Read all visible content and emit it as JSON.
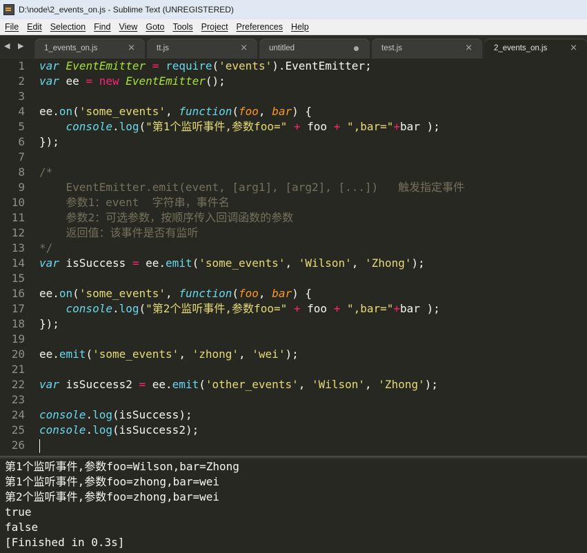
{
  "window": {
    "title": "D:\\node\\2_events_on.js - Sublime Text (UNREGISTERED)"
  },
  "menu": [
    "File",
    "Edit",
    "Selection",
    "Find",
    "View",
    "Goto",
    "Tools",
    "Project",
    "Preferences",
    "Help"
  ],
  "tabbar": {
    "nav": "◀ ▶"
  },
  "tabs": [
    {
      "label": "1_events_on.js",
      "state": "close",
      "close": "×"
    },
    {
      "label": "tt.js",
      "state": "close",
      "close": "×"
    },
    {
      "label": "untitled",
      "state": "modified"
    },
    {
      "label": "test.js",
      "state": "close",
      "close": "×"
    },
    {
      "label": "2_events_on.js",
      "state": "active",
      "close": "×"
    }
  ],
  "code_lines": [
    {
      "n": "1",
      "tokens": [
        [
          "kw",
          "var"
        ],
        [
          "pl",
          " "
        ],
        [
          "cls",
          "EventEmitter"
        ],
        [
          "pl",
          " "
        ],
        [
          "op",
          "="
        ],
        [
          "pl",
          " "
        ],
        [
          "fn",
          "require"
        ],
        [
          "pl",
          "("
        ],
        [
          "str",
          "'events'"
        ],
        [
          "pl",
          ").EventEmitter;"
        ]
      ]
    },
    {
      "n": "2",
      "tokens": [
        [
          "kw",
          "var"
        ],
        [
          "pl",
          " ee "
        ],
        [
          "op",
          "="
        ],
        [
          "pl",
          " "
        ],
        [
          "op",
          "new"
        ],
        [
          "pl",
          " "
        ],
        [
          "cls",
          "EventEmitter"
        ],
        [
          "pl",
          "();"
        ]
      ]
    },
    {
      "n": "3",
      "tokens": []
    },
    {
      "n": "4",
      "tokens": [
        [
          "pl",
          "ee."
        ],
        [
          "fn",
          "on"
        ],
        [
          "pl",
          "("
        ],
        [
          "str",
          "'some_events'"
        ],
        [
          "pl",
          ", "
        ],
        [
          "kw",
          "function"
        ],
        [
          "pl",
          "("
        ],
        [
          "prm",
          "foo"
        ],
        [
          "pl",
          ", "
        ],
        [
          "prm",
          "bar"
        ],
        [
          "pl",
          ") {"
        ]
      ]
    },
    {
      "n": "5",
      "tokens": [
        [
          "pl",
          "    "
        ],
        [
          "kw",
          "console"
        ],
        [
          "pl",
          "."
        ],
        [
          "fn",
          "log"
        ],
        [
          "pl",
          "("
        ],
        [
          "str",
          "\"第1个监听事件,参数foo=\""
        ],
        [
          "pl",
          " "
        ],
        [
          "op",
          "+"
        ],
        [
          "pl",
          " foo "
        ],
        [
          "op",
          "+"
        ],
        [
          "pl",
          " "
        ],
        [
          "str",
          "\",bar=\""
        ],
        [
          "op",
          "+"
        ],
        [
          "pl",
          "bar );"
        ]
      ]
    },
    {
      "n": "6",
      "tokens": [
        [
          "pl",
          "});"
        ]
      ]
    },
    {
      "n": "7",
      "tokens": []
    },
    {
      "n": "8",
      "tokens": [
        [
          "cm",
          "/*"
        ]
      ]
    },
    {
      "n": "9",
      "tokens": [
        [
          "cm",
          "    EventEmitter.emit(event, [arg1], [arg2], [...])   触发指定事件"
        ]
      ]
    },
    {
      "n": "10",
      "tokens": [
        [
          "cm",
          "    参数1：event  字符串，事件名"
        ]
      ]
    },
    {
      "n": "11",
      "tokens": [
        [
          "cm",
          "    参数2：可选参数，按顺序传入回调函数的参数"
        ]
      ]
    },
    {
      "n": "12",
      "tokens": [
        [
          "cm",
          "    返回值：该事件是否有监听"
        ]
      ]
    },
    {
      "n": "13",
      "tokens": [
        [
          "cm",
          "*/"
        ]
      ]
    },
    {
      "n": "14",
      "tokens": [
        [
          "kw",
          "var"
        ],
        [
          "pl",
          " isSuccess "
        ],
        [
          "op",
          "="
        ],
        [
          "pl",
          " ee."
        ],
        [
          "fn",
          "emit"
        ],
        [
          "pl",
          "("
        ],
        [
          "str",
          "'some_events'"
        ],
        [
          "pl",
          ", "
        ],
        [
          "str",
          "'Wilson'"
        ],
        [
          "pl",
          ", "
        ],
        [
          "str",
          "'Zhong'"
        ],
        [
          "pl",
          ");"
        ]
      ]
    },
    {
      "n": "15",
      "tokens": []
    },
    {
      "n": "16",
      "tokens": [
        [
          "pl",
          "ee."
        ],
        [
          "fn",
          "on"
        ],
        [
          "pl",
          "("
        ],
        [
          "str",
          "'some_events'"
        ],
        [
          "pl",
          ", "
        ],
        [
          "kw",
          "function"
        ],
        [
          "pl",
          "("
        ],
        [
          "prm",
          "foo"
        ],
        [
          "pl",
          ", "
        ],
        [
          "prm",
          "bar"
        ],
        [
          "pl",
          ") {"
        ]
      ]
    },
    {
      "n": "17",
      "tokens": [
        [
          "pl",
          "    "
        ],
        [
          "kw",
          "console"
        ],
        [
          "pl",
          "."
        ],
        [
          "fn",
          "log"
        ],
        [
          "pl",
          "("
        ],
        [
          "str",
          "\"第2个监听事件,参数foo=\""
        ],
        [
          "pl",
          " "
        ],
        [
          "op",
          "+"
        ],
        [
          "pl",
          " foo "
        ],
        [
          "op",
          "+"
        ],
        [
          "pl",
          " "
        ],
        [
          "str",
          "\",bar=\""
        ],
        [
          "op",
          "+"
        ],
        [
          "pl",
          "bar );"
        ]
      ]
    },
    {
      "n": "18",
      "tokens": [
        [
          "pl",
          "});"
        ]
      ]
    },
    {
      "n": "19",
      "tokens": []
    },
    {
      "n": "20",
      "tokens": [
        [
          "pl",
          "ee."
        ],
        [
          "fn",
          "emit"
        ],
        [
          "pl",
          "("
        ],
        [
          "str",
          "'some_events'"
        ],
        [
          "pl",
          ", "
        ],
        [
          "str",
          "'zhong'"
        ],
        [
          "pl",
          ", "
        ],
        [
          "str",
          "'wei'"
        ],
        [
          "pl",
          ");"
        ]
      ]
    },
    {
      "n": "21",
      "tokens": []
    },
    {
      "n": "22",
      "tokens": [
        [
          "kw",
          "var"
        ],
        [
          "pl",
          " isSuccess2 "
        ],
        [
          "op",
          "="
        ],
        [
          "pl",
          " ee."
        ],
        [
          "fn",
          "emit"
        ],
        [
          "pl",
          "("
        ],
        [
          "str",
          "'other_events'"
        ],
        [
          "pl",
          ", "
        ],
        [
          "str",
          "'Wilson'"
        ],
        [
          "pl",
          ", "
        ],
        [
          "str",
          "'Zhong'"
        ],
        [
          "pl",
          ");"
        ]
      ]
    },
    {
      "n": "23",
      "tokens": []
    },
    {
      "n": "24",
      "tokens": [
        [
          "kw",
          "console"
        ],
        [
          "pl",
          "."
        ],
        [
          "fn",
          "log"
        ],
        [
          "pl",
          "(isSuccess);"
        ]
      ]
    },
    {
      "n": "25",
      "tokens": [
        [
          "kw",
          "console"
        ],
        [
          "pl",
          "."
        ],
        [
          "fn",
          "log"
        ],
        [
          "pl",
          "(isSuccess2);"
        ]
      ]
    },
    {
      "n": "26",
      "tokens": []
    }
  ],
  "console_output": [
    "第1个监听事件,参数foo=Wilson,bar=Zhong",
    "第1个监听事件,参数foo=zhong,bar=wei",
    "第2个监听事件,参数foo=zhong,bar=wei",
    "true",
    "false",
    "[Finished in 0.3s]"
  ],
  "colors": {
    "background": "#272822",
    "keyword": "#66d9ef",
    "class": "#a6e22e",
    "string": "#e6db74",
    "operator": "#f92672",
    "param": "#fd971f",
    "comment": "#75715e"
  }
}
